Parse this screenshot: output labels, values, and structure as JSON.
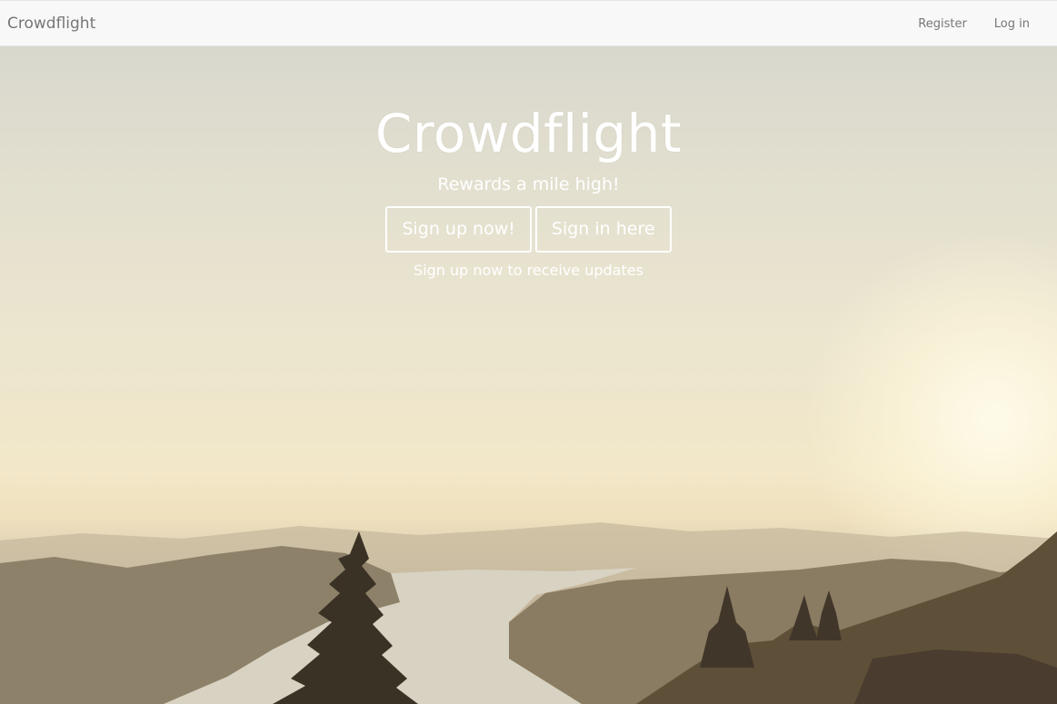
{
  "navbar": {
    "brand": "Crowdflight",
    "links": {
      "register": "Register",
      "login": "Log in"
    }
  },
  "hero": {
    "title": "Crowdflight",
    "tagline": "Rewards a mile high!",
    "buttons": {
      "signup": "Sign up now!",
      "signin": "Sign in here"
    },
    "note": "Sign up now to receive updates"
  },
  "colors": {
    "navbar_bg": "#f8f8f8",
    "navbar_text": "#777777",
    "hero_text": "#ffffff"
  }
}
